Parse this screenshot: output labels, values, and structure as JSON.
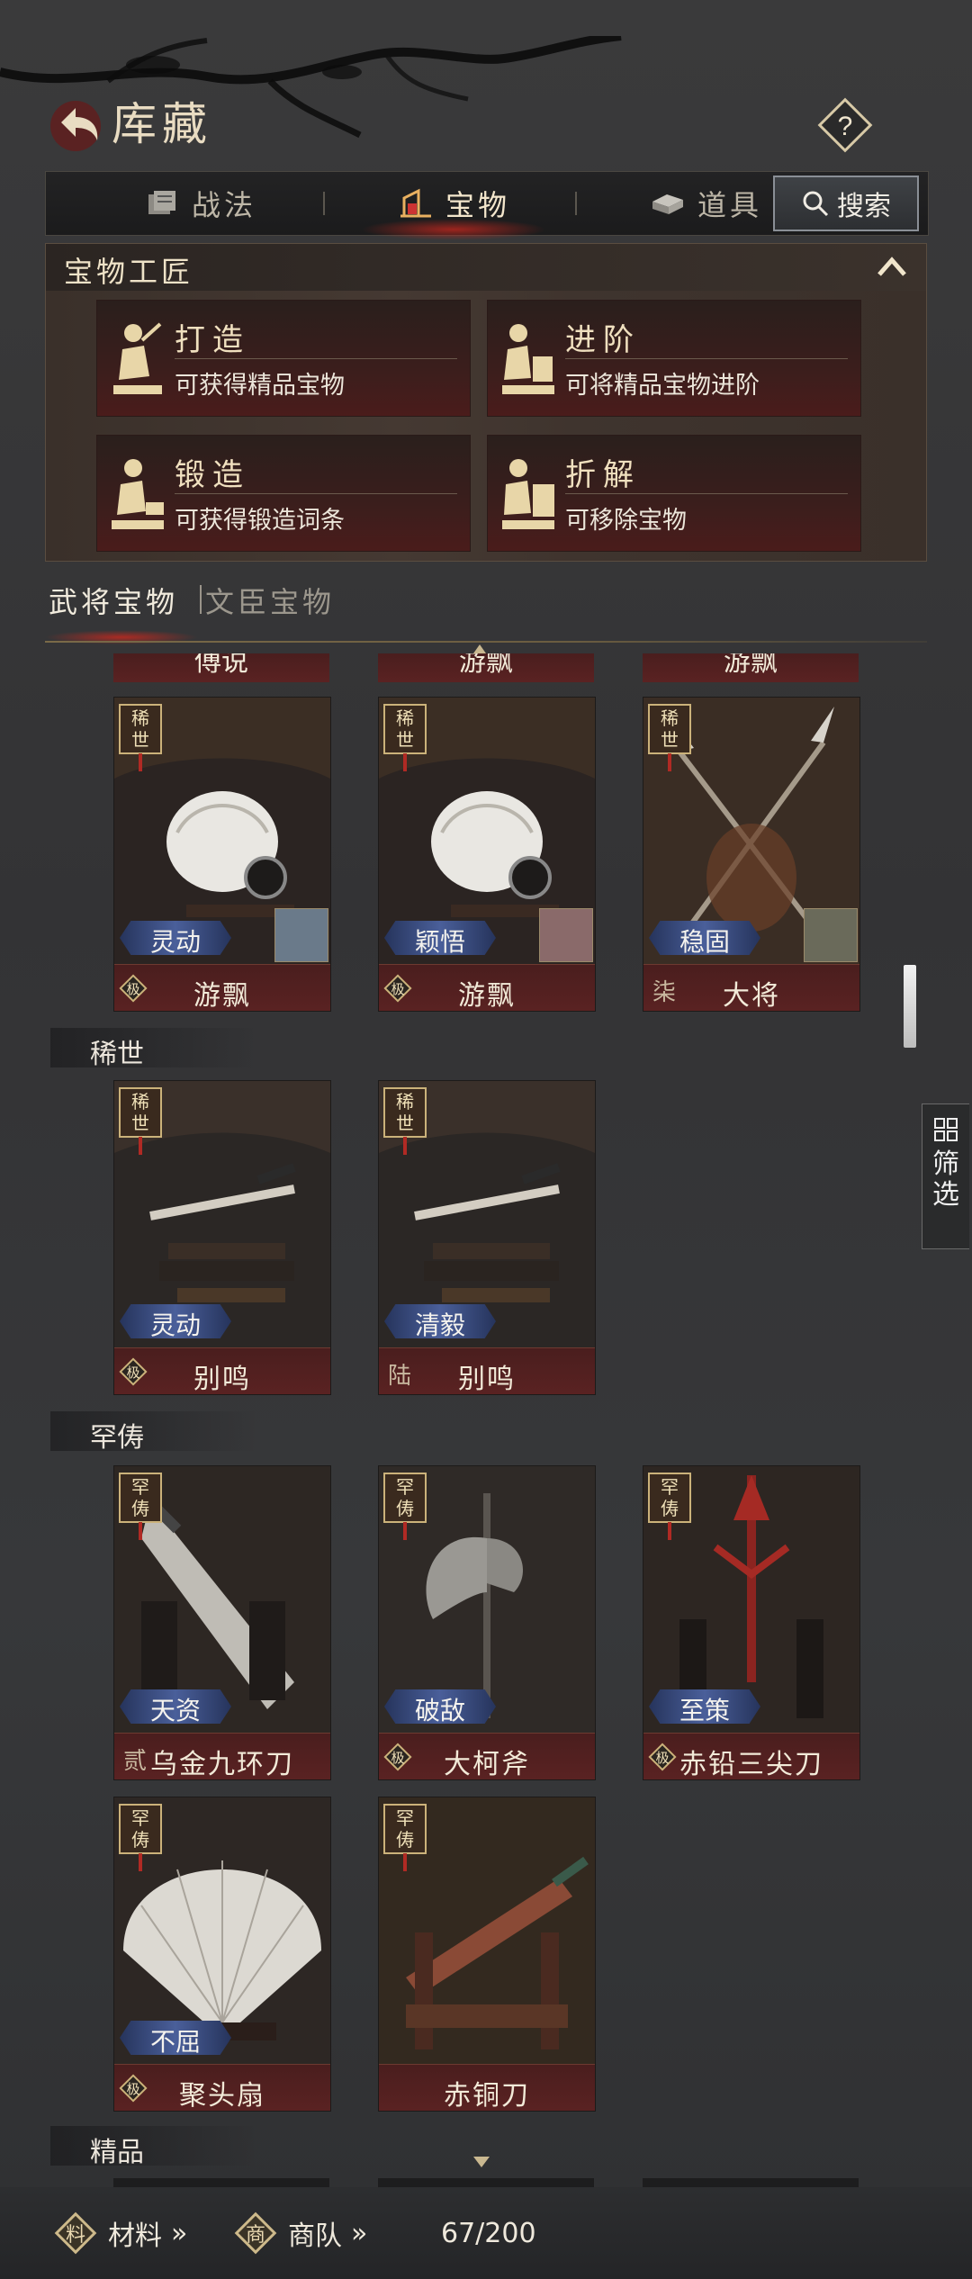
{
  "header": {
    "title": "库藏"
  },
  "tabs": [
    {
      "label": "战法"
    },
    {
      "label": "宝物"
    },
    {
      "label": "道具"
    }
  ],
  "search": {
    "label": "搜索"
  },
  "artisan": {
    "title": "宝物工匠",
    "cards": [
      {
        "name": "打造",
        "desc": "可获得精品宝物"
      },
      {
        "name": "进阶",
        "desc": "可将精品宝物进阶"
      },
      {
        "name": "锻造",
        "desc": "可获得锻造词条"
      },
      {
        "name": "折解",
        "desc": "可移除宝物"
      }
    ]
  },
  "categories": {
    "first": "武将宝物",
    "second": "文臣宝物"
  },
  "partial_row": {
    "items": [
      "傅说",
      "游飘",
      "游飘"
    ]
  },
  "sections": {
    "rare": "稀世",
    "scarce": "罕俦",
    "fine": "精品"
  },
  "items_top": [
    {
      "trait": "灵动",
      "name": "游飘",
      "rank": "极",
      "badge": "稀世"
    },
    {
      "trait": "颖悟",
      "name": "游飘",
      "rank": "极",
      "badge": "稀世"
    },
    {
      "trait": "稳固",
      "name": "大将",
      "rank": "柒",
      "badge": "稀世"
    }
  ],
  "items_rare": [
    {
      "trait": "灵动",
      "name": "别鸣",
      "rank": "极",
      "badge": "稀世"
    },
    {
      "trait": "清毅",
      "name": "别鸣",
      "rank": "陆",
      "badge": "稀世"
    }
  ],
  "items_scarce": [
    {
      "trait": "天资",
      "name": "乌金九环刀",
      "rank": "贰",
      "badge": "罕俦"
    },
    {
      "trait": "破敌",
      "name": "大柯斧",
      "rank": "极",
      "badge": "罕俦"
    },
    {
      "trait": "至策",
      "name": "赤铅三尖刀",
      "rank": "极",
      "badge": "罕俦"
    },
    {
      "trait": "不屈",
      "name": "聚头扇",
      "rank": "极",
      "badge": "罕俦"
    },
    {
      "trait": "",
      "name": "赤铜刀",
      "rank": "",
      "badge": "罕俦"
    }
  ],
  "filter": {
    "label": "筛选"
  },
  "bottom": {
    "materials": "材料",
    "materials_icon": "料",
    "caravan": "商队",
    "caravan_icon": "商",
    "arrows": "»",
    "capacity": "67/200"
  }
}
